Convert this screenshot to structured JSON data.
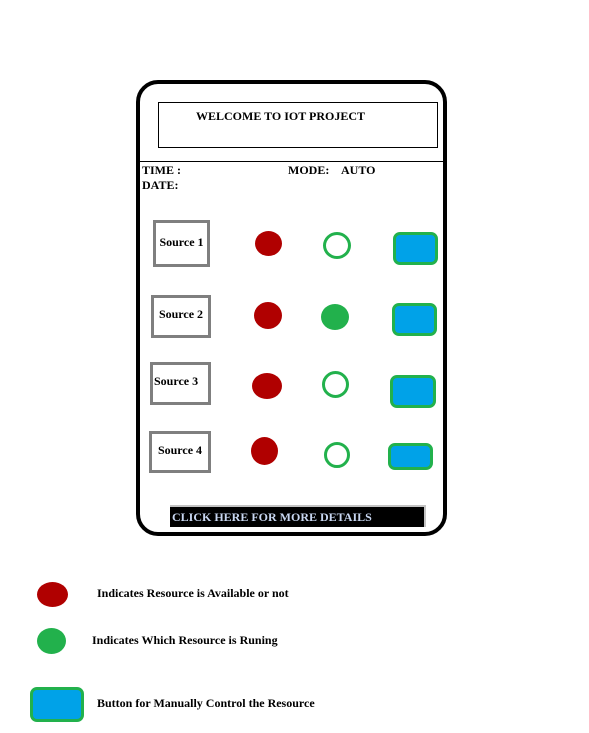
{
  "header": {
    "title": "WELCOME TO IOT PROJECT",
    "time_label": "TIME :",
    "date_label": "DATE:",
    "mode_label": "MODE:",
    "mode_value": "AUTO"
  },
  "sources": [
    {
      "label": "Source 1",
      "available": true,
      "running": false
    },
    {
      "label": "Source 2",
      "available": true,
      "running": true
    },
    {
      "label": "Source 3",
      "available": true,
      "running": false
    },
    {
      "label": "Source 4",
      "available": true,
      "running": false
    }
  ],
  "details_link": "CLICK HERE FOR MORE DETAILS",
  "legend": {
    "available": "Indicates Resource is Available or not",
    "running": "Indicates Which Resource is Runing",
    "button": "Button for Manually Control the Resource"
  },
  "colors": {
    "available": "#b00000",
    "running": "#22b14c",
    "button_fill": "#00a2e8",
    "button_border": "#22b14c"
  }
}
